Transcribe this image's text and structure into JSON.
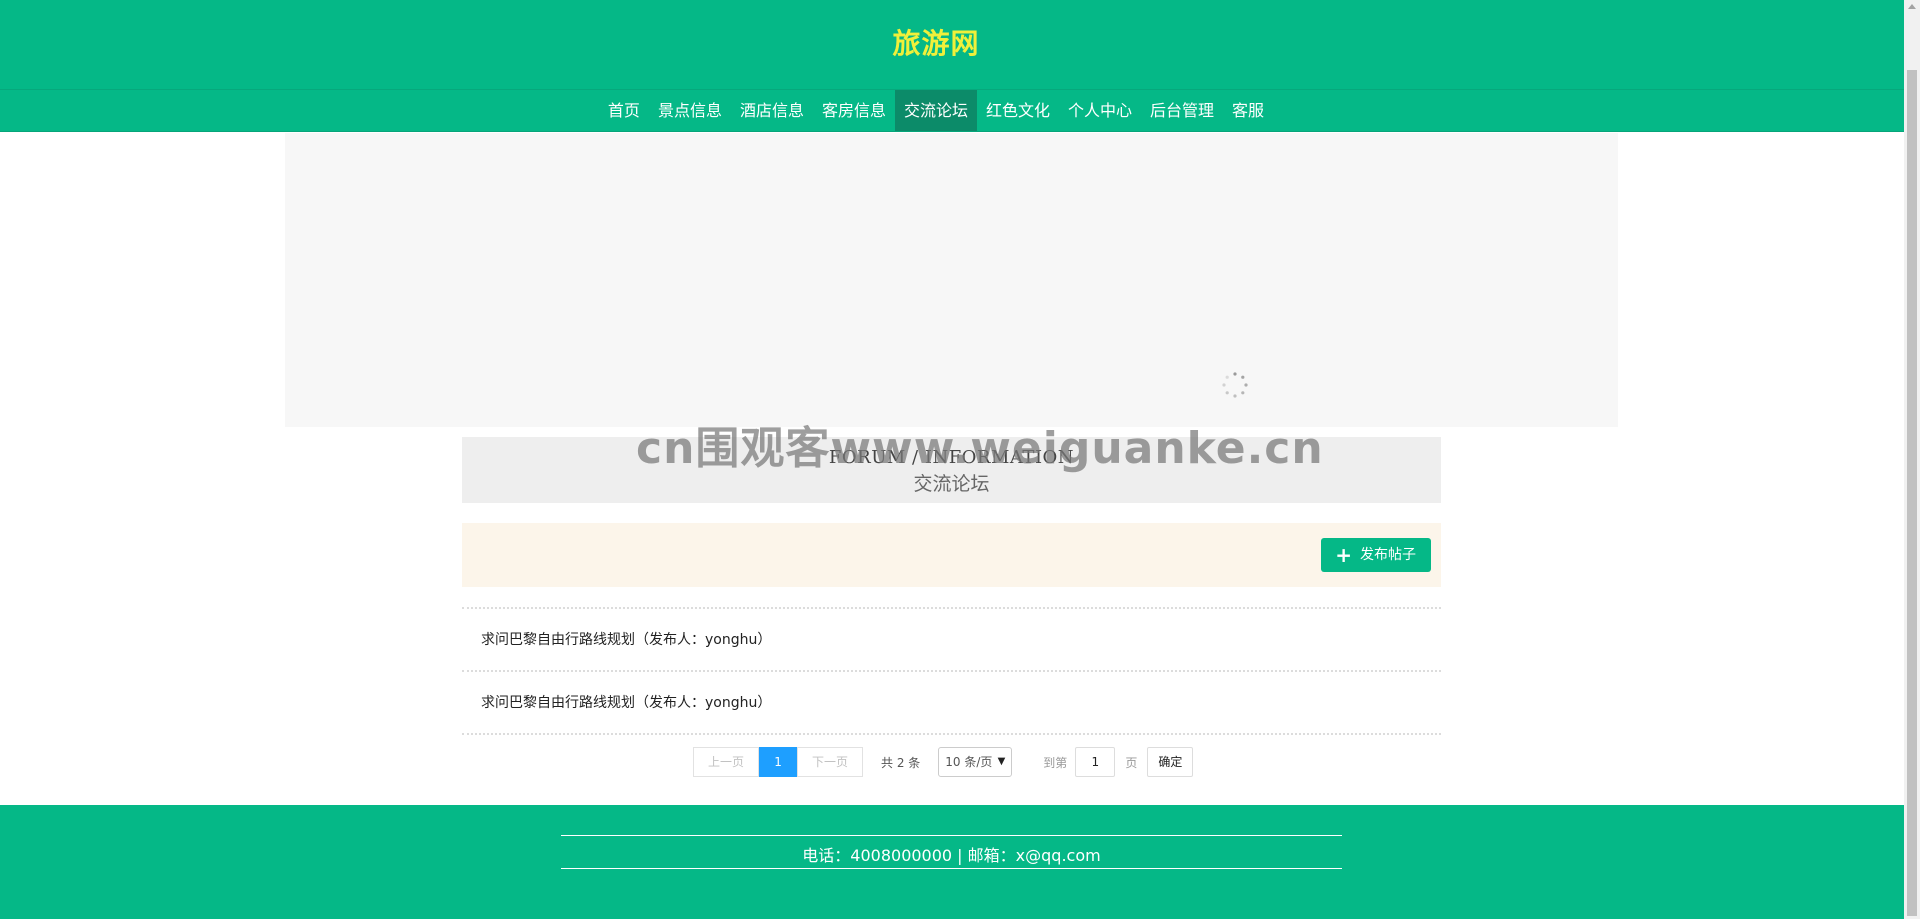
{
  "site": {
    "title": "旅游网"
  },
  "nav": {
    "items": [
      {
        "label": "首页"
      },
      {
        "label": "景点信息"
      },
      {
        "label": "酒店信息"
      },
      {
        "label": "客房信息"
      },
      {
        "label": "交流论坛",
        "active": true
      },
      {
        "label": "红色文化"
      },
      {
        "label": "个人中心"
      },
      {
        "label": "后台管理"
      },
      {
        "label": "客服"
      }
    ]
  },
  "banner": {
    "state": "loading"
  },
  "section": {
    "title_en": "FORUM / INFORMATION",
    "title_cn": "交流论坛"
  },
  "watermark": {
    "text": "cn围观客www.weiguanke.cn"
  },
  "toolbar": {
    "post_button": "发布帖子",
    "post_icon": "plus-icon"
  },
  "posts": [
    {
      "title": "求问巴黎自由行路线规划（发布人：yonghu）"
    },
    {
      "title": "求问巴黎自由行路线规划（发布人：yonghu）"
    }
  ],
  "pagination": {
    "prev": "上一页",
    "current": "1",
    "next": "下一页",
    "total": "共 2 条",
    "page_size": "10 条/页",
    "goto_label": "到第",
    "goto_value": "1",
    "page_label": "页",
    "confirm": "确定"
  },
  "footer": {
    "contact": "电话：4008000000 | 邮箱：x@qq.com"
  },
  "colors": {
    "primary": "#05b887",
    "title": "#f0f03a",
    "active_nav": "#0c8b69",
    "pager_current": "#1e9fff"
  }
}
